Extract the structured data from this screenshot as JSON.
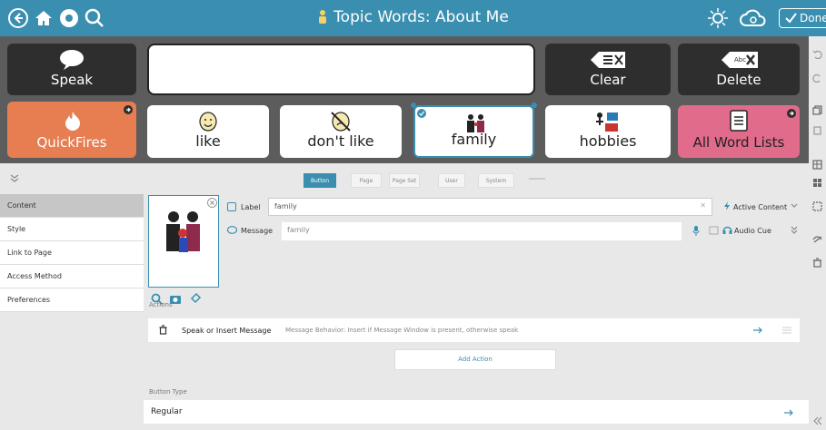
{
  "topbar": {
    "title": "Topic Words: About Me",
    "done_label": "Done",
    "icons": [
      "back-arrow-icon",
      "home-icon",
      "settings-icon",
      "search-icon",
      "brightness-icon",
      "cloud-sync-icon"
    ]
  },
  "grid": {
    "speak": "Speak",
    "clear": "Clear",
    "delete": "Delete",
    "delete_badge": "Abc",
    "quickfires": "QuickFires",
    "like": "like",
    "dont_like": "don't like",
    "family": "family",
    "hobbies": "hobbies",
    "all_word_lists": "All Word Lists"
  },
  "tabs": [
    "Button",
    "Page",
    "Page Set",
    "User",
    "System"
  ],
  "leftnav": [
    "Content",
    "Style",
    "Link to Page",
    "Access Method",
    "Preferences"
  ],
  "content": {
    "label_caption": "Label",
    "label_value": "family",
    "message_caption": "Message",
    "message_value": "family",
    "active_content": "Active Content",
    "audio_cue": "Audio Cue"
  },
  "actions": {
    "section_label": "Actions",
    "action_title": "Speak or Insert Message",
    "action_desc": "Message Behavior: Insert if Message Window is present, otherwise speak",
    "add_action": "Add Action"
  },
  "button_type": {
    "section_label": "Button Type",
    "value": "Regular"
  },
  "colors": {
    "accent": "#3a8fb0",
    "quickfires": "#e67e52",
    "all_word_lists": "#e06b8a",
    "dark_tile": "#2e2e2e"
  }
}
